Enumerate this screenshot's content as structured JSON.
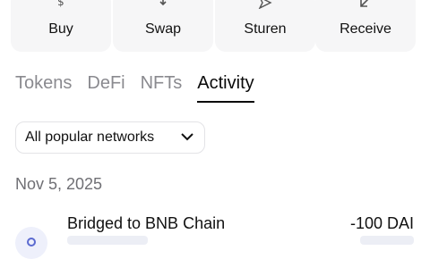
{
  "actions": [
    {
      "label": "Buy",
      "icon": "dollar-icon"
    },
    {
      "label": "Swap",
      "icon": "swap-arrows-icon"
    },
    {
      "label": "Sturen",
      "icon": "send-icon"
    },
    {
      "label": "Receive",
      "icon": "receive-arrow-icon"
    }
  ],
  "tabs": [
    {
      "label": "Tokens",
      "active": false
    },
    {
      "label": "DeFi",
      "active": false
    },
    {
      "label": "NFTs",
      "active": false
    },
    {
      "label": "Activity",
      "active": true
    }
  ],
  "filter": {
    "label": "All popular networks",
    "icon": "chevron-down-icon"
  },
  "activity": {
    "date": "Nov 5, 2025",
    "items": [
      {
        "title": "Bridged to BNB Chain",
        "amount": "-100 DAI",
        "icon": "bridge-icon"
      }
    ]
  }
}
